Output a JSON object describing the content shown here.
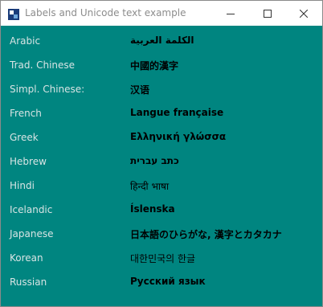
{
  "window": {
    "title": "Labels and Unicode text example",
    "controls": {
      "minimize": "minimize-icon",
      "maximize": "maximize-icon",
      "close": "close-icon"
    },
    "colors": {
      "background": "#008580",
      "label_text": "#d8e4e4",
      "sample_text": "#000000",
      "title_text": "#8c8c8c",
      "app_icon": "#1a3c7a"
    }
  },
  "rows": [
    {
      "language": "Arabic",
      "sample": "الكلمة العربية"
    },
    {
      "language": "Trad. Chinese",
      "sample": "中國的漢字"
    },
    {
      "language": "Simpl. Chinese:",
      "sample": "汉语"
    },
    {
      "language": "French",
      "sample": "Langue française"
    },
    {
      "language": "Greek",
      "sample": "Ελληνική γλώσσα"
    },
    {
      "language": "Hebrew",
      "sample": "כתב עברית"
    },
    {
      "language": "Hindi",
      "sample": "हिन्दी भाषा"
    },
    {
      "language": "Icelandic",
      "sample": "Íslenska"
    },
    {
      "language": "Japanese",
      "sample": "日本語のひらがな, 漢字とカタカナ"
    },
    {
      "language": "Korean",
      "sample": "대한민국의 한글"
    },
    {
      "language": "Russian",
      "sample": "Русский язык"
    }
  ]
}
